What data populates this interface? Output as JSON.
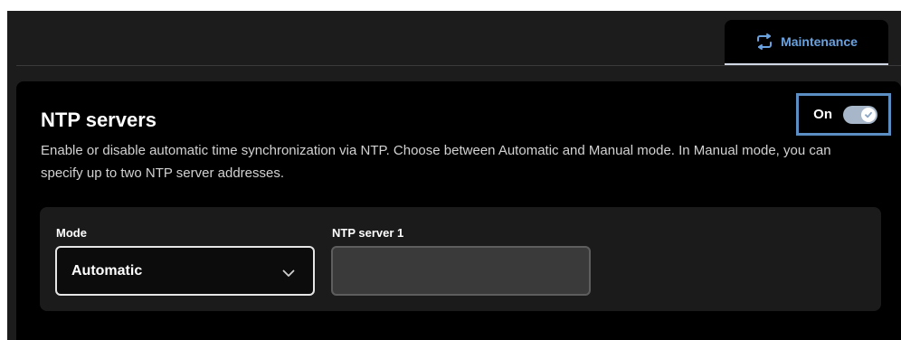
{
  "tabs": [
    {
      "label": "Maintenance",
      "icon": "sync-icon",
      "active": true
    }
  ],
  "ntp": {
    "title": "NTP servers",
    "description": "Enable or disable automatic time synchronization via NTP. Choose between Automatic and Manual mode. In Manual mode, you can specify up to two NTP server addresses.",
    "toggle": {
      "label": "On",
      "enabled": true
    },
    "mode": {
      "label": "Mode",
      "value": "Automatic"
    },
    "server1": {
      "label": "NTP server 1",
      "value": ""
    }
  },
  "colors": {
    "accent": "#6aa2e0",
    "focus_outline": "#5b8fc4"
  }
}
